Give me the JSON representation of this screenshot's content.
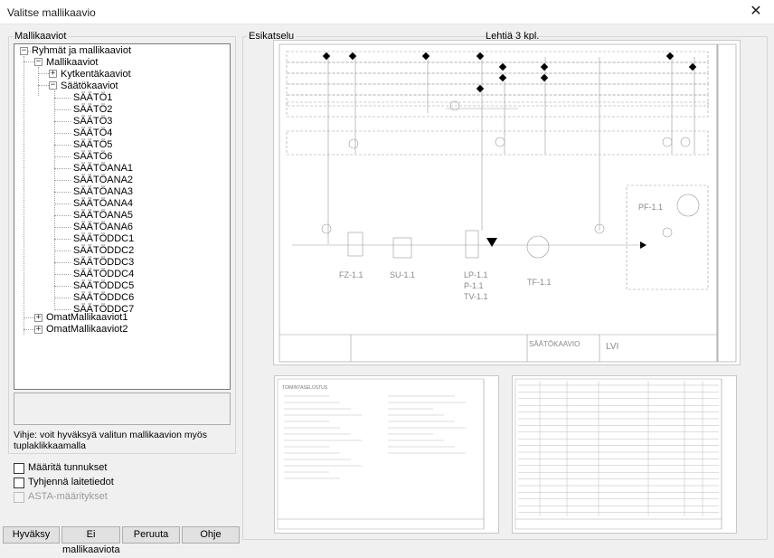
{
  "window": {
    "title": "Valitse mallikaavio",
    "close_glyph": "✕"
  },
  "left_panel": {
    "group_label": "Mallikaaviot",
    "tree": {
      "root": "Ryhmät ja mallikaaviot",
      "mallikaaviot": "Mallikaaviot",
      "kytkentakaaviot": "Kytkentäkaaviot",
      "saatokaaviot": "Säätökaaviot",
      "items": [
        "SÄÄTÖ1",
        "SÄÄTÖ2",
        "SÄÄTÖ3",
        "SÄÄTÖ4",
        "SÄÄTÖ5",
        "SÄÄTÖ6",
        "SÄÄTÖANA1",
        "SÄÄTÖANA2",
        "SÄÄTÖANA3",
        "SÄÄTÖANA4",
        "SÄÄTÖANA5",
        "SÄÄTÖANA6",
        "SÄÄTÖDDC1",
        "SÄÄTÖDDC2",
        "SÄÄTÖDDC3",
        "SÄÄTÖDDC4",
        "SÄÄTÖDDC5",
        "SÄÄTÖDDC6",
        "SÄÄTÖDDC7"
      ],
      "oma1": "OmatMallikaaviot1",
      "oma2": "OmatMallikaaviot2",
      "expand_plus": "+",
      "expand_minus": "−"
    },
    "hint": "Vihje: voit hyväksyä valitun mallikaavion myös tuplaklikkaamalla"
  },
  "options": {
    "maarita": "Määritä tunnukset",
    "tyhjenna": "Tyhjennä laitetiedot",
    "asta": "ASTA-määritykset"
  },
  "buttons": {
    "hyvaksy": "Hyväksy",
    "ei": "Ei mallikaaviota",
    "peruuta": "Peruuta",
    "ohje": "Ohje"
  },
  "preview": {
    "group_label": "Esikatselu",
    "page_count": "Lehtiä 3 kpl.",
    "sheet1": {
      "labels": [
        "FZ-1.1",
        "SU-1.1",
        "LP-1.1",
        "P-1.1",
        "TV-1.1",
        "TF-1.1",
        "PF-1.1"
      ],
      "title_block": "SÄÄTÖKAAVIO",
      "lvi": "LVI"
    },
    "sheet2": {
      "heading": "TOIMINTASELOSTUS"
    }
  }
}
